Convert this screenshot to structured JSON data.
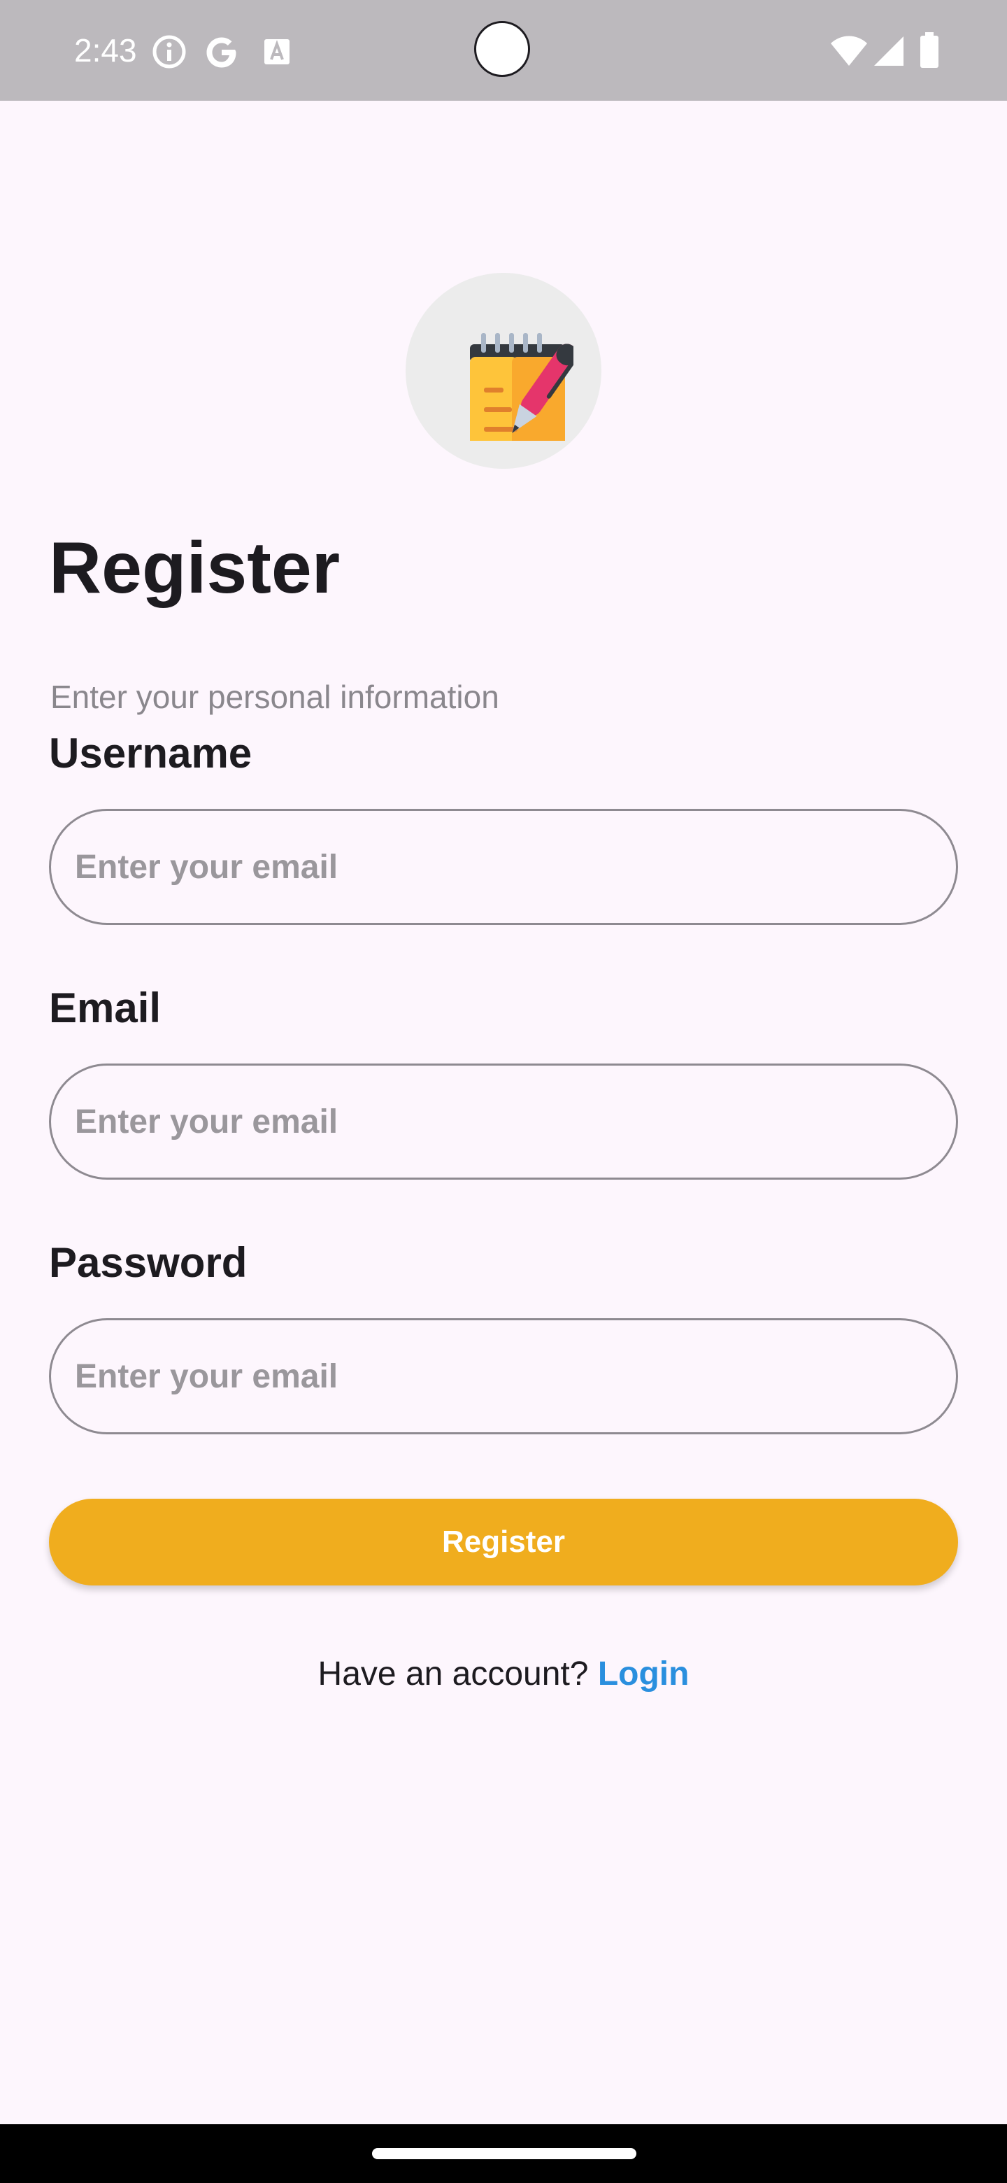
{
  "status_bar": {
    "time": "2:43",
    "icons": [
      "info-icon",
      "google-g-icon",
      "font-a-icon",
      "wifi-icon",
      "signal-icon",
      "battery-icon"
    ]
  },
  "logo": {
    "icon": "notepad-pen-icon"
  },
  "page": {
    "title": "Register",
    "subtitle": "Enter your personal information"
  },
  "form": {
    "username": {
      "label": "Username",
      "value": "",
      "placeholder": "Enter your email"
    },
    "email": {
      "label": "Email",
      "value": "",
      "placeholder": "Enter your email"
    },
    "password": {
      "label": "Password",
      "value": "",
      "placeholder": "Enter your email"
    },
    "submit_label": "Register"
  },
  "footer": {
    "prompt": "Have an account?",
    "login_label": "Login"
  },
  "colors": {
    "background": "#fdf6fd",
    "status_bar": "#bcb9bd",
    "button": "#f0ad1e",
    "link": "#2a8fde",
    "text": "#1d1b20",
    "muted": "#8a878d"
  }
}
